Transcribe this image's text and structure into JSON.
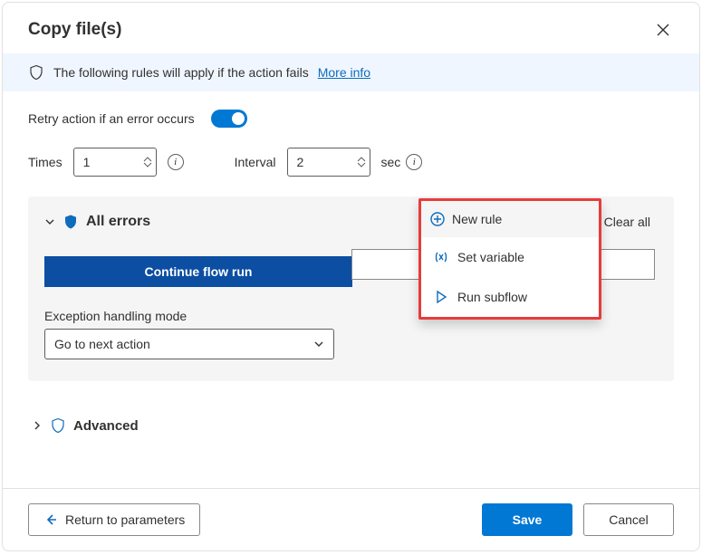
{
  "header": {
    "title": "Copy file(s)"
  },
  "info": {
    "text": "The following rules will apply if the action fails",
    "link": "More info"
  },
  "retry": {
    "label": "Retry action if an error occurs",
    "times_label": "Times",
    "times_value": "1",
    "interval_label": "Interval",
    "interval_value": "2",
    "interval_unit": "sec"
  },
  "errors": {
    "title": "All errors",
    "new_rule": "New rule",
    "clear_all": "Clear all",
    "continue": "Continue flow run",
    "menu": {
      "set_variable": "Set variable",
      "run_subflow": "Run subflow"
    },
    "mode_label": "Exception handling mode",
    "mode_value": "Go to next action"
  },
  "advanced": {
    "label": "Advanced"
  },
  "footer": {
    "return": "Return to parameters",
    "save": "Save",
    "cancel": "Cancel"
  }
}
